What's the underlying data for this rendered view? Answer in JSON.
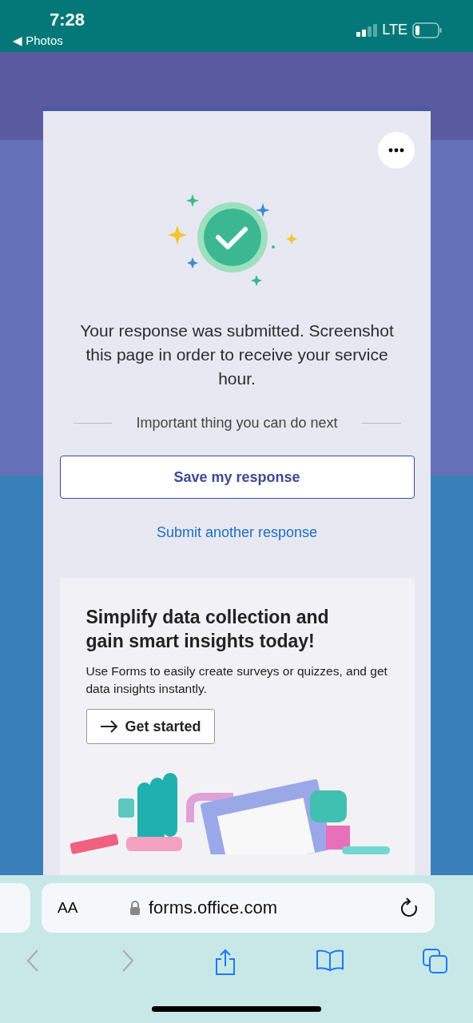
{
  "status_bar": {
    "time": "7:28",
    "back_label": "◀ Photos",
    "network": "LTE"
  },
  "confirmation": {
    "message": "Your response was submitted. Screenshot this page in order to receive your service hour.",
    "next_heading": "Important thing you can do next",
    "save_button": "Save my response",
    "another_link": "Submit another response"
  },
  "promo": {
    "title": "Simplify data collection and gain smart insights today!",
    "body": "Use Forms to easily create surveys or quizzes, and get data insights instantly.",
    "button": "Get started"
  },
  "browser": {
    "text_size": "AA",
    "url": "forms.office.com",
    "back_disabled": true,
    "forward_disabled": true
  }
}
